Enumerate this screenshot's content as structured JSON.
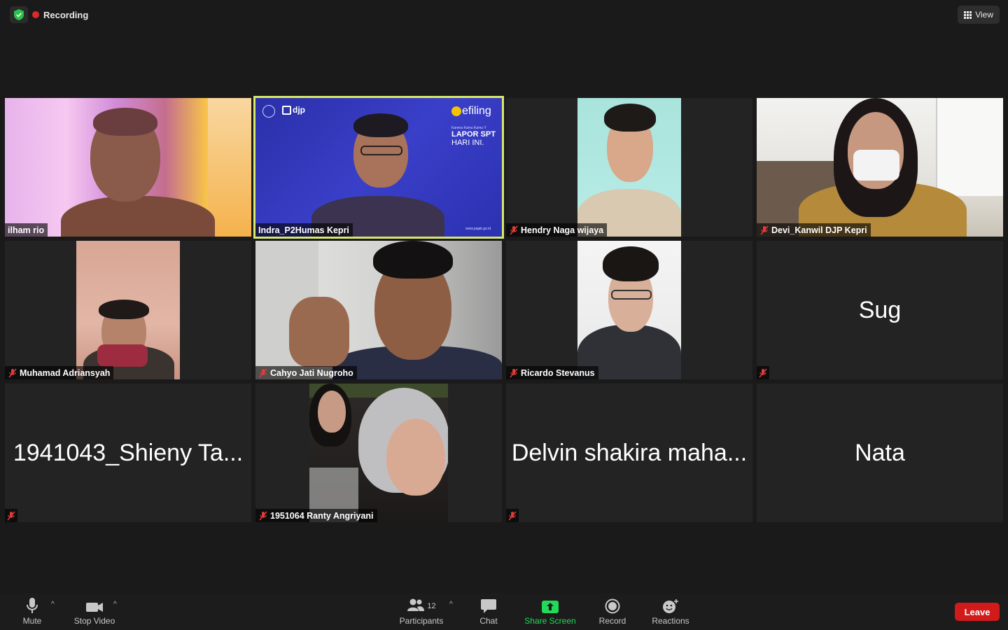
{
  "meeting": {
    "recording_label": "Recording",
    "view_label": "View"
  },
  "participants": [
    {
      "name": "ilham rio",
      "video": true,
      "muted": false
    },
    {
      "name": "Indra_P2Humas Kepri",
      "video": true,
      "muted": false,
      "active_speaker": true
    },
    {
      "name": "Hendry Naga wijaya",
      "video": true,
      "muted": true
    },
    {
      "name": "Devi_Kanwil DJP Kepri",
      "video": true,
      "muted": true
    },
    {
      "name": "Muhamad Adriansyah",
      "video": true,
      "muted": true
    },
    {
      "name": "Cahyo Jati Nugroho",
      "video": true,
      "muted": true
    },
    {
      "name": "Ricardo Stevanus",
      "video": true,
      "muted": true
    },
    {
      "name": "Sug",
      "video": false,
      "muted": true
    },
    {
      "name": "1941043_Shieny Ta...",
      "video": false,
      "muted": true
    },
    {
      "name": "1951064 Ranty Angriyani",
      "video": true,
      "muted": true
    },
    {
      "name": "Delvin shakira maha...",
      "video": false,
      "muted": true
    },
    {
      "name": "Nata",
      "video": false,
      "muted": false
    }
  ],
  "shared_background": {
    "brand": "djp",
    "product": "efiling",
    "tagline_small": "Karena Kamu Kamu Y",
    "headline_1": "LAPOR SPT",
    "headline_2": "HARI INI.",
    "url": "www.pajak.go.id"
  },
  "toolbar": {
    "mute_label": "Mute",
    "stop_video_label": "Stop Video",
    "participants_label": "Participants",
    "participants_count": "12",
    "chat_label": "Chat",
    "share_screen_label": "Share Screen",
    "record_label": "Record",
    "reactions_label": "Reactions",
    "leave_label": "Leave"
  },
  "colors": {
    "background": "#1a1a1a",
    "tile": "#232323",
    "active_speaker_border": "#d7e86a",
    "share_screen_green": "#23d959",
    "leave_red": "#d11a1a",
    "recording_red": "#e02828"
  }
}
